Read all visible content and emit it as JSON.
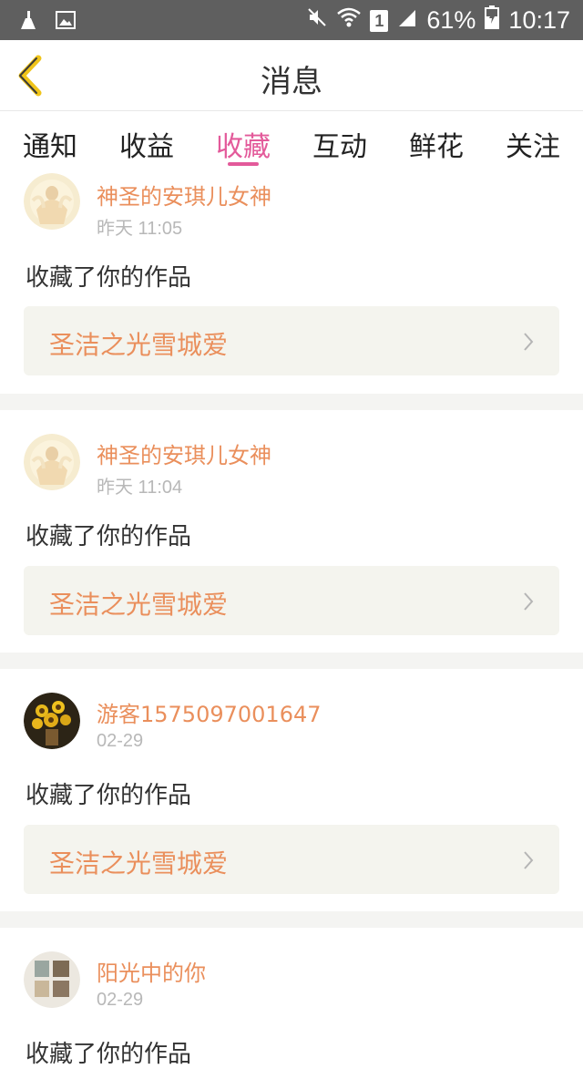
{
  "status_bar": {
    "battery": "61%",
    "time": "10:17",
    "sim_label": "1"
  },
  "header": {
    "title": "消息"
  },
  "tabs": [
    {
      "label": "通知"
    },
    {
      "label": "收益"
    },
    {
      "label": "收藏",
      "active": true
    },
    {
      "label": "互动"
    },
    {
      "label": "鲜花"
    },
    {
      "label": "关注"
    }
  ],
  "messages": [
    {
      "user": "神圣的安琪儿女神",
      "time": "昨天 11:05",
      "action": "收藏了你的作品",
      "work_title": "圣洁之光雪城爱",
      "avatar": "angel"
    },
    {
      "user": "神圣的安琪儿女神",
      "time": "昨天 11:04",
      "action": "收藏了你的作品",
      "work_title": "圣洁之光雪城爱",
      "avatar": "angel"
    },
    {
      "user": "游客1575097001647",
      "time": "02-29",
      "action": "收藏了你的作品",
      "work_title": "圣洁之光雪城爱",
      "avatar": "sunflower"
    },
    {
      "user": "阳光中的你",
      "time": "02-29",
      "action": "收藏了你的作品",
      "work_title": "",
      "avatar": "collage"
    }
  ],
  "colors": {
    "accent": "#e35a9a",
    "name": "#ea8f5c",
    "back": "#f0c419"
  }
}
